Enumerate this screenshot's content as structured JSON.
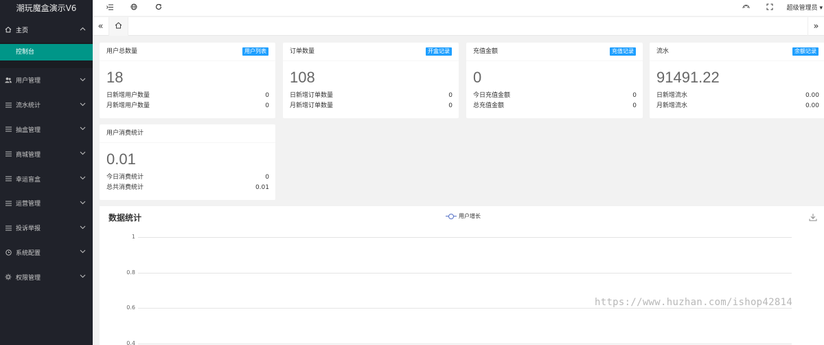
{
  "app": {
    "title": "潮玩魔盒演示V6"
  },
  "sidebar": {
    "home": {
      "label": "主页",
      "icon": "home-icon"
    },
    "home_sub": {
      "label": "控制台"
    },
    "items": [
      {
        "label": "用户管理",
        "icon": "users-icon"
      },
      {
        "label": "流水统计",
        "icon": "list-icon"
      },
      {
        "label": "抽盒管理",
        "icon": "list-icon"
      },
      {
        "label": "商城管理",
        "icon": "list-icon"
      },
      {
        "label": "幸运盲盒",
        "icon": "list-icon"
      },
      {
        "label": "运营管理",
        "icon": "list-icon"
      },
      {
        "label": "投诉举报",
        "icon": "list-icon"
      },
      {
        "label": "系统配置",
        "icon": "settings-circle-icon"
      },
      {
        "label": "权限管理",
        "icon": "gear-icon"
      }
    ]
  },
  "header": {
    "admin_label": "超级管理员",
    "icons": [
      "menu-toggle-icon",
      "globe-icon",
      "refresh-icon",
      "theme-icon",
      "fullscreen-icon"
    ]
  },
  "tabs": {
    "home_icon": "home-icon"
  },
  "cards": [
    {
      "title": "用户总数量",
      "badge": "用户列表",
      "value": "18",
      "rows": [
        {
          "label": "日新增用户数量",
          "value": "0"
        },
        {
          "label": "月新增用户数量",
          "value": "0"
        }
      ]
    },
    {
      "title": "订单数量",
      "badge": "开盒记录",
      "value": "108",
      "rows": [
        {
          "label": "日新增订单数量",
          "value": "0"
        },
        {
          "label": "月新增订单数量",
          "value": "0"
        }
      ]
    },
    {
      "title": "充值金额",
      "badge": "充值记录",
      "value": "0",
      "rows": [
        {
          "label": "今日充值金额",
          "value": "0"
        },
        {
          "label": "总充值金额",
          "value": "0"
        }
      ]
    },
    {
      "title": "流水",
      "badge": "余额记录",
      "value": "91491.22",
      "rows": [
        {
          "label": "日新增流水",
          "value": "0.00"
        },
        {
          "label": "月新增流水",
          "value": "0.00"
        }
      ]
    },
    {
      "title": "用户消费统计",
      "badge": "",
      "value": "0.01",
      "rows": [
        {
          "label": "今日消费统计",
          "value": "0"
        },
        {
          "label": "总共消费统计",
          "value": "0.01"
        }
      ]
    }
  ],
  "chart": {
    "title": "数据统计",
    "legend": "用户增长",
    "series_color": "#5470c6",
    "download_icon": "download-icon"
  },
  "chart_data": {
    "type": "line",
    "title": "数据统计",
    "series": [
      {
        "name": "用户增长",
        "values": []
      }
    ],
    "y_ticks": [
      "1",
      "0.8",
      "0.6",
      "0.4"
    ],
    "ylim": [
      0.4,
      1
    ],
    "grid": true,
    "legend": "top-center"
  },
  "watermark": "https://www.huzhan.com/ishop42814"
}
